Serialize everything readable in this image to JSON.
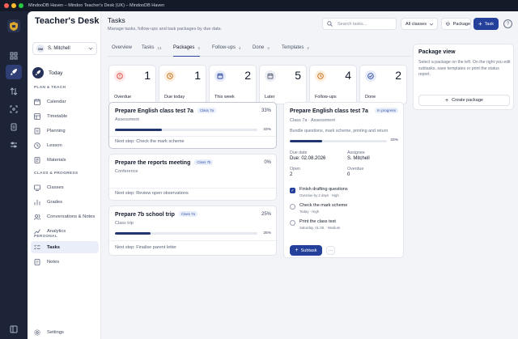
{
  "window": {
    "title": "MindooDB Haven – Mindoo Teacher's Desk (UK) – MindooDB Haven"
  },
  "sidebar": {
    "brand": "Teacher's Desk",
    "user": {
      "initials": "SM",
      "name": "S. Mitchell"
    },
    "today_label": "Today",
    "sections": [
      {
        "title": "PLAN & TEACH",
        "items": [
          {
            "label": "Calendar",
            "icon": "calendar-icon"
          },
          {
            "label": "Timetable",
            "icon": "timetable-icon"
          },
          {
            "label": "Planning",
            "icon": "planning-icon"
          },
          {
            "label": "Lesson",
            "icon": "lesson-icon"
          },
          {
            "label": "Materials",
            "icon": "materials-icon"
          }
        ]
      },
      {
        "title": "CLASS & PROGRESS",
        "items": [
          {
            "label": "Classes",
            "icon": "classes-icon"
          },
          {
            "label": "Grades",
            "icon": "grades-icon"
          },
          {
            "label": "Conversations & Notes",
            "icon": "conversations-icon"
          },
          {
            "label": "Analytics",
            "icon": "analytics-icon"
          }
        ]
      },
      {
        "title": "PERSONAL",
        "items": [
          {
            "label": "Tasks",
            "icon": "tasks-icon",
            "active": true
          },
          {
            "label": "Notes",
            "icon": "notes-icon"
          }
        ]
      }
    ],
    "settings_label": "Settings"
  },
  "header": {
    "title": "Tasks",
    "subtitle": "Manage tasks, follow-ups and task packages by due date.",
    "search_placeholder": "Search tasks...",
    "filter_value": "All classes",
    "package_button": "Package",
    "task_button": "Task",
    "help_label": "?"
  },
  "tabs": [
    {
      "label": "Overview",
      "count": ""
    },
    {
      "label": "Tasks",
      "count": "13"
    },
    {
      "label": "Packages",
      "count": "3",
      "active": true
    },
    {
      "label": "Follow-ups",
      "count": "4"
    },
    {
      "label": "Done",
      "count": "2"
    },
    {
      "label": "Templates",
      "count": "2"
    }
  ],
  "stats": [
    {
      "label": "Overdue",
      "value": "1",
      "icon": "alert-icon",
      "color": "#d9433b",
      "bg": "#fde8e6"
    },
    {
      "label": "Due today",
      "value": "1",
      "icon": "clock-icon",
      "color": "#c26a12",
      "bg": "#fdeedd"
    },
    {
      "label": "This week",
      "value": "2",
      "icon": "calendar-icon",
      "color": "#2d47a0",
      "bg": "#e6ebfa"
    },
    {
      "label": "Later",
      "value": "5",
      "icon": "calendar-later-icon",
      "color": "#5a6278",
      "bg": "#eceef3"
    },
    {
      "label": "Follow-ups",
      "value": "4",
      "icon": "follow-up-icon",
      "color": "#c26a12",
      "bg": "#fdeedd"
    },
    {
      "label": "Done",
      "value": "2",
      "icon": "check-circle-icon",
      "color": "#2d47a0",
      "bg": "#e6ebfa"
    }
  ],
  "packages": [
    {
      "title": "Prepare English class test 7a",
      "class": "Class 7a",
      "category": "Assessment",
      "progress": 33,
      "progress_label": "33%",
      "next_step": "Next step: Check the mark scheme",
      "selected": true
    },
    {
      "title": "Prepare the reports meeting",
      "class": "Class 7b",
      "category": "Conference",
      "progress": 0,
      "progress_label": "0%",
      "next_step": "Next step: Review open observations"
    },
    {
      "title": "Prepare 7b school trip",
      "class": "Class 7a",
      "category": "Class trip",
      "progress": 25,
      "progress_label": "25%",
      "next_step": "Next step: Finalise parent letter"
    }
  ],
  "detail": {
    "title": "Prepare English class test 7a",
    "status": "In progress",
    "subtitle": "Class 7a · Assessment",
    "description": "Bundle questions, mark scheme, printing and return",
    "progress": 33,
    "progress_label": "33%",
    "fields": [
      {
        "label": "Due date",
        "value": "Due: 02.08.2026"
      },
      {
        "label": "Assignee",
        "value": "S. Mitchell"
      },
      {
        "label": "Open",
        "value": "2"
      },
      {
        "label": "Overdue",
        "value": "0"
      }
    ],
    "subtasks": [
      {
        "title": "Finish drafting questions",
        "meta": "Overdue by 2 days · High",
        "done": true
      },
      {
        "title": "Check the mark scheme",
        "meta": "Today · High",
        "done": false
      },
      {
        "title": "Print the class test",
        "meta": "Saturday, 01.08. · Medium",
        "done": false
      }
    ],
    "subtask_button": "Subtask",
    "more_label": "···"
  },
  "package_view": {
    "title": "Package view",
    "text": "Select a package on the left. On the right you edit subtasks, save templates or print the status report.",
    "button": "Create package"
  }
}
